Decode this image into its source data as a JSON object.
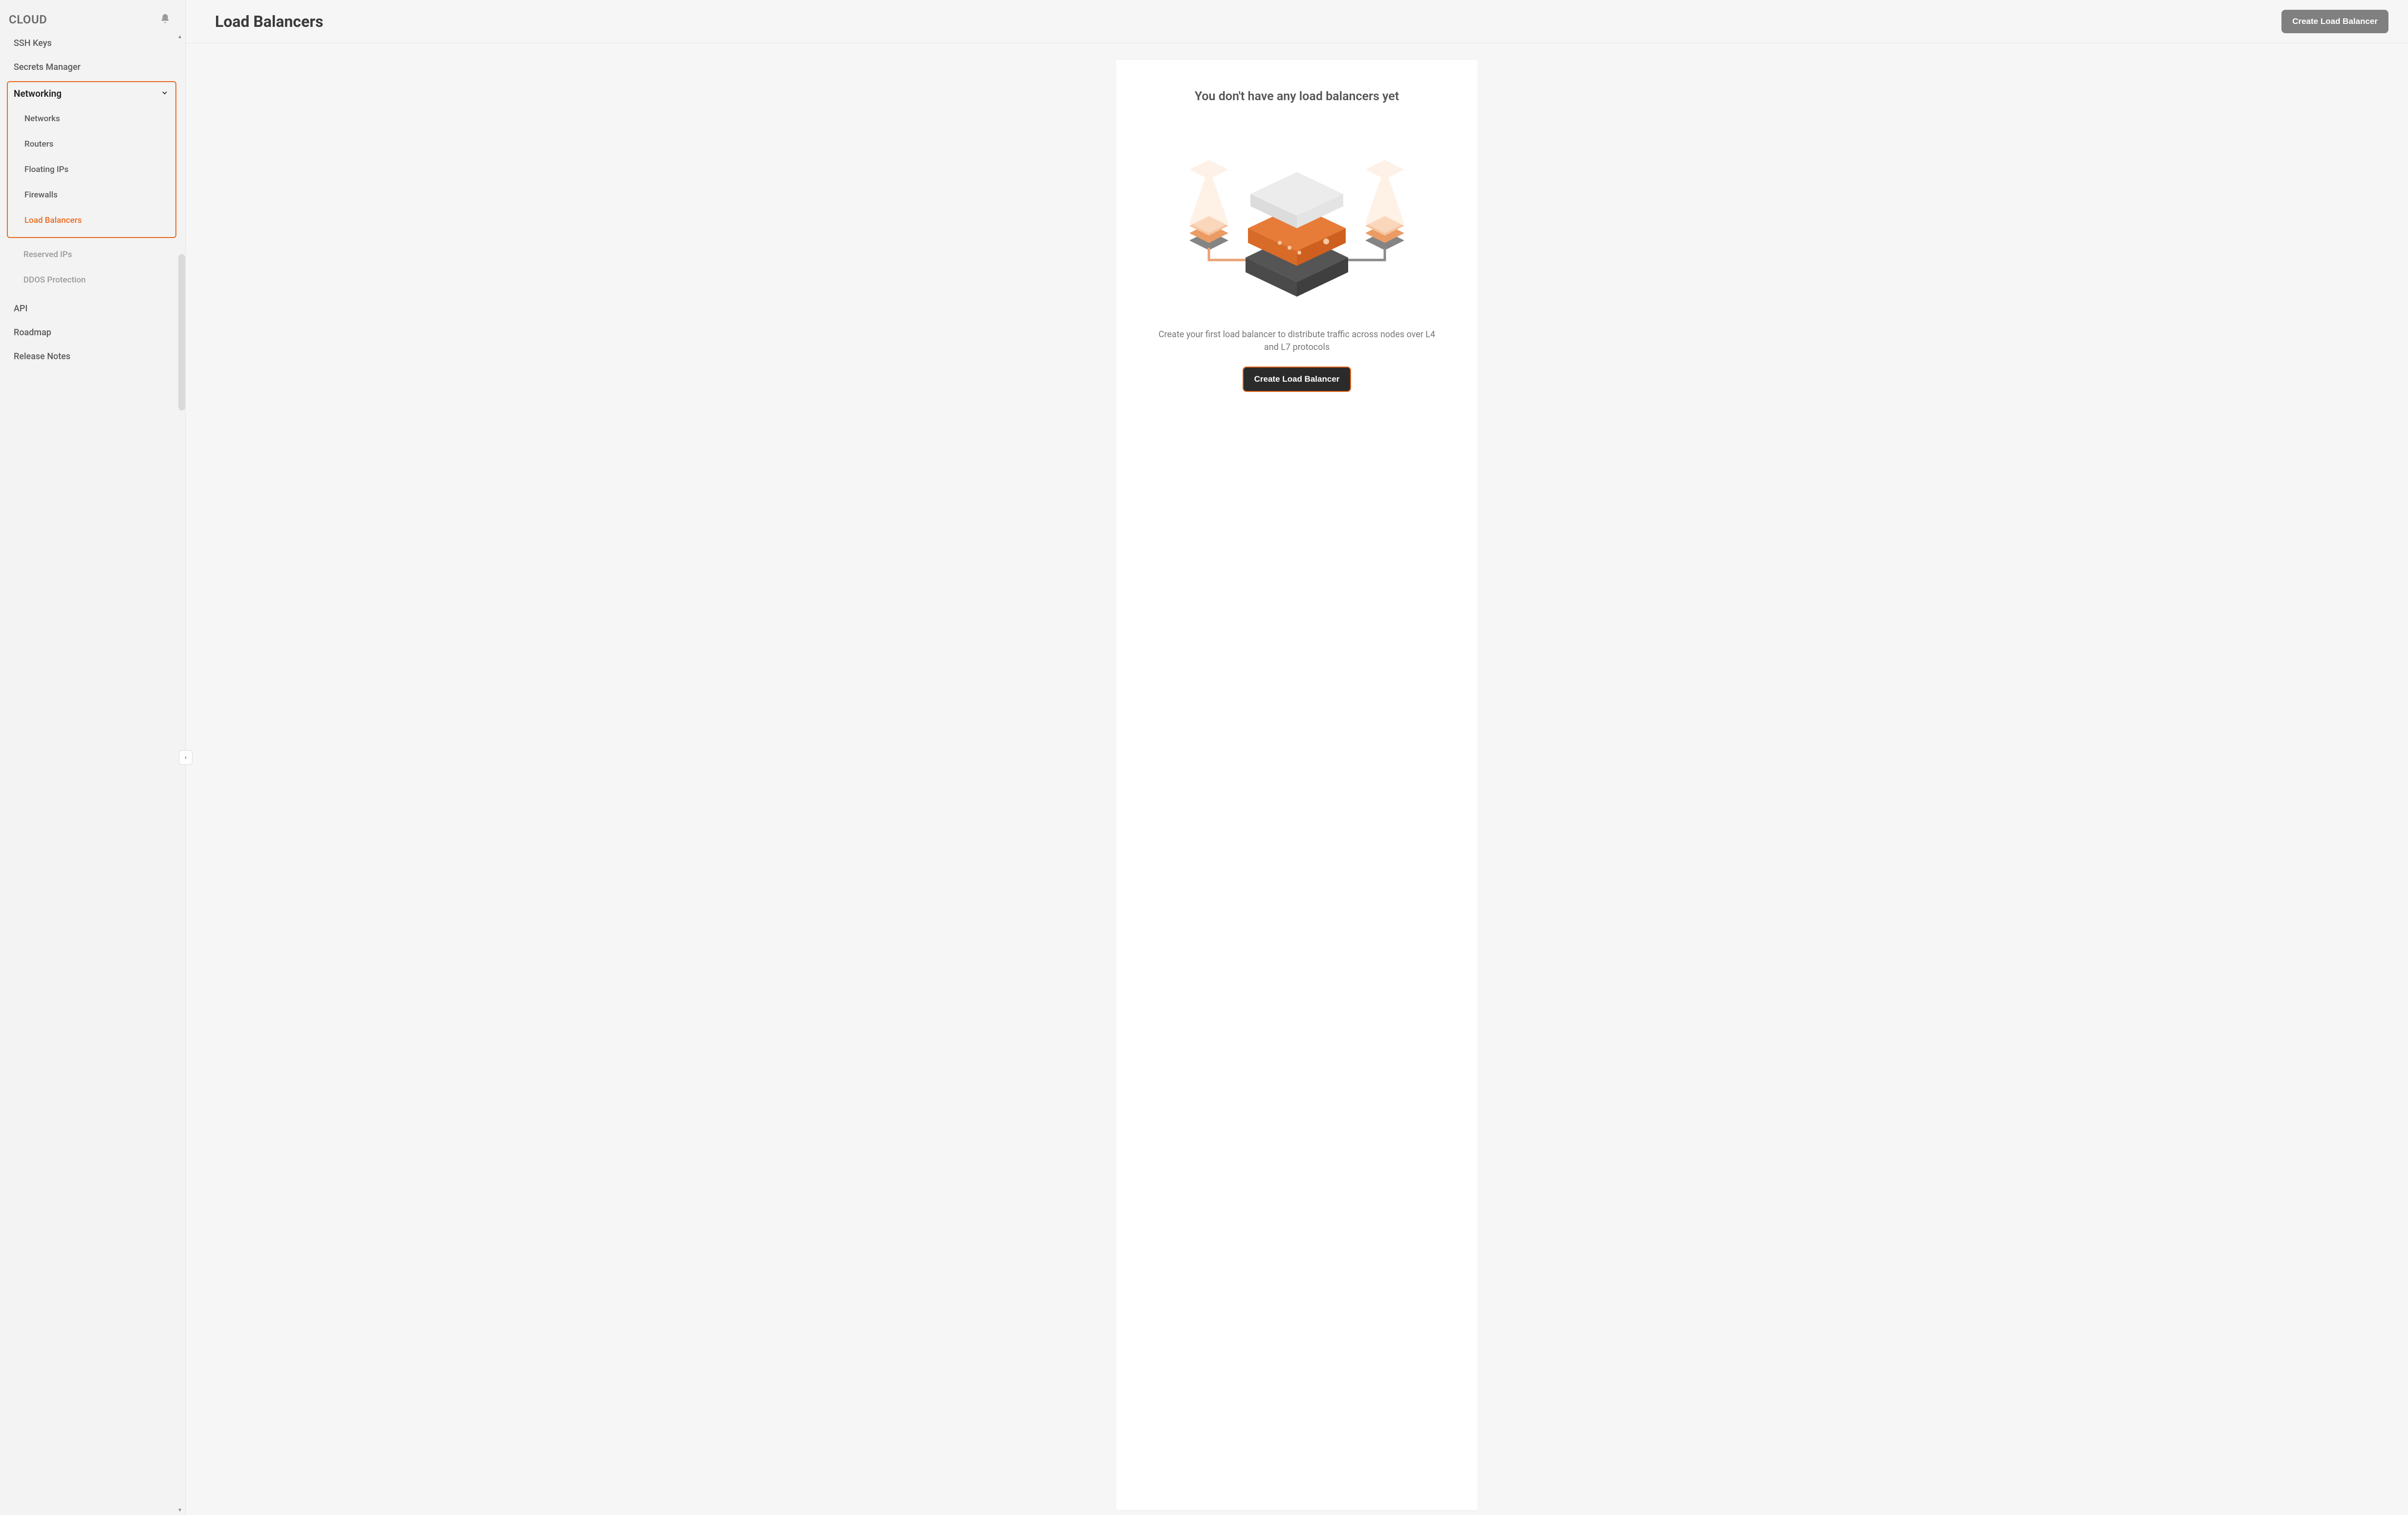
{
  "brand": "CLOUD",
  "sidebar": {
    "top_items": [
      {
        "label": "SSH Keys"
      },
      {
        "label": "Secrets Manager"
      }
    ],
    "section": {
      "label": "Networking",
      "expanded": true,
      "items": [
        {
          "label": "Networks",
          "active": false,
          "dim": false
        },
        {
          "label": "Routers",
          "active": false,
          "dim": false
        },
        {
          "label": "Floating IPs",
          "active": false,
          "dim": false
        },
        {
          "label": "Firewalls",
          "active": false,
          "dim": false
        },
        {
          "label": "Load Balancers",
          "active": true,
          "dim": false
        },
        {
          "label": "Reserved IPs",
          "active": false,
          "dim": true
        },
        {
          "label": "DDOS Protection",
          "active": false,
          "dim": true
        }
      ]
    },
    "bottom_items": [
      {
        "label": "API"
      },
      {
        "label": "Roadmap"
      },
      {
        "label": "Release Notes"
      }
    ]
  },
  "header": {
    "title": "Load Balancers",
    "primary_button": "Create Load Balancer"
  },
  "empty_state": {
    "title": "You don't have any load balancers yet",
    "subtitle": "Create your first load balancer to distribute traffic across nodes over L4 and L7 protocols",
    "cta": "Create Load Balancer"
  },
  "colors": {
    "accent": "#e86a1f",
    "btn_grey": "#808080",
    "btn_dark": "#2b2b2b"
  }
}
